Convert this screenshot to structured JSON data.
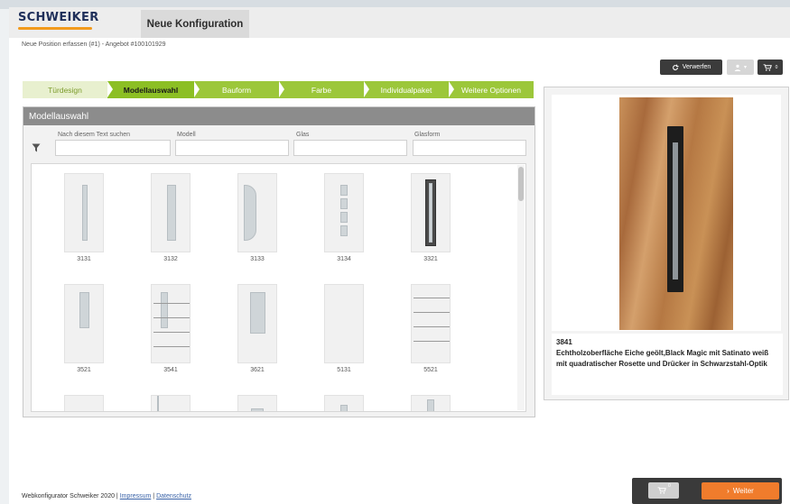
{
  "header": {
    "logo": "SCHWEIKER",
    "tab_label": "Neue Konfiguration"
  },
  "subheader": "Neue Position erfassen (#1) - Angebot #100101929",
  "toolbar": {
    "discard_label": "Verwerfen",
    "cart_badge": "0"
  },
  "steps": [
    {
      "label": "Türdesign",
      "state": "done"
    },
    {
      "label": "Modellauswahl",
      "state": "active"
    },
    {
      "label": "Bauform",
      "state": "todo"
    },
    {
      "label": "Farbe",
      "state": "todo"
    },
    {
      "label": "Individualpaket",
      "state": "todo"
    },
    {
      "label": "Weitere Optionen",
      "state": "todo"
    }
  ],
  "panel": {
    "title": "Modellauswahl",
    "filters": [
      {
        "label": "Nach diesem Text suchen",
        "value": ""
      },
      {
        "label": "Modell",
        "value": ""
      },
      {
        "label": "Glas",
        "value": ""
      },
      {
        "label": "Glasform",
        "value": ""
      }
    ],
    "models": [
      "3131",
      "3132",
      "3133",
      "3134",
      "3321",
      "3521",
      "3541",
      "3621",
      "5131",
      "5521"
    ]
  },
  "preview": {
    "model_number": "3841",
    "description_line1": "Echtholzoberfläche Eiche geölt,Black Magic mit Satinato weiß",
    "description_line2": "mit quadratischer Rosette und Drücker in Schwarzstahl-Optik"
  },
  "footer": {
    "text": "Webkonfigurator Schweiker 2020 |",
    "link_impressum": "Impressum",
    "separator": "|",
    "link_datenschutz": "Datenschutz"
  },
  "actions": {
    "next_label": "Weiter",
    "cart_badge": "0"
  },
  "colors": {
    "accent_orange": "#f07c2c",
    "step_green": "#9cc73a",
    "step_active": "#8cbf24",
    "brand_navy": "#1f2f5a"
  }
}
